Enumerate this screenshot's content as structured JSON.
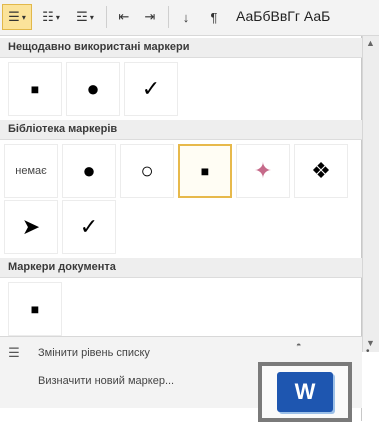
{
  "ribbon": {
    "preview_text": "АаБбВвГг АаБ",
    "buttons": [
      {
        "name": "bullets-button",
        "glyph": "☰"
      },
      {
        "name": "numbering-button",
        "glyph": "☷"
      },
      {
        "name": "multilevel-list-button",
        "glyph": "☲"
      },
      {
        "name": "decrease-indent-button",
        "glyph": "⇤"
      },
      {
        "name": "increase-indent-button",
        "glyph": "⇥"
      },
      {
        "name": "sort-button",
        "glyph": "↓"
      },
      {
        "name": "show-marks-button",
        "glyph": "¶"
      }
    ]
  },
  "sections": {
    "recent": {
      "title": "Нещодавно використані маркери",
      "items": [
        "■",
        "●",
        "✓"
      ]
    },
    "library": {
      "title": "Бібліотека маркерів",
      "items": [
        "немає",
        "●",
        "○",
        "■",
        "✦",
        "❖",
        "➤",
        "✓"
      ]
    },
    "document": {
      "title": "Маркери документа",
      "items": [
        "■"
      ]
    }
  },
  "menu": {
    "change_level": "Змінити рівень списку",
    "define_new": "Визначити новий маркер..."
  },
  "colors": {
    "accent_selected": "#e7b94b",
    "word_blue": "#1e56b0"
  }
}
